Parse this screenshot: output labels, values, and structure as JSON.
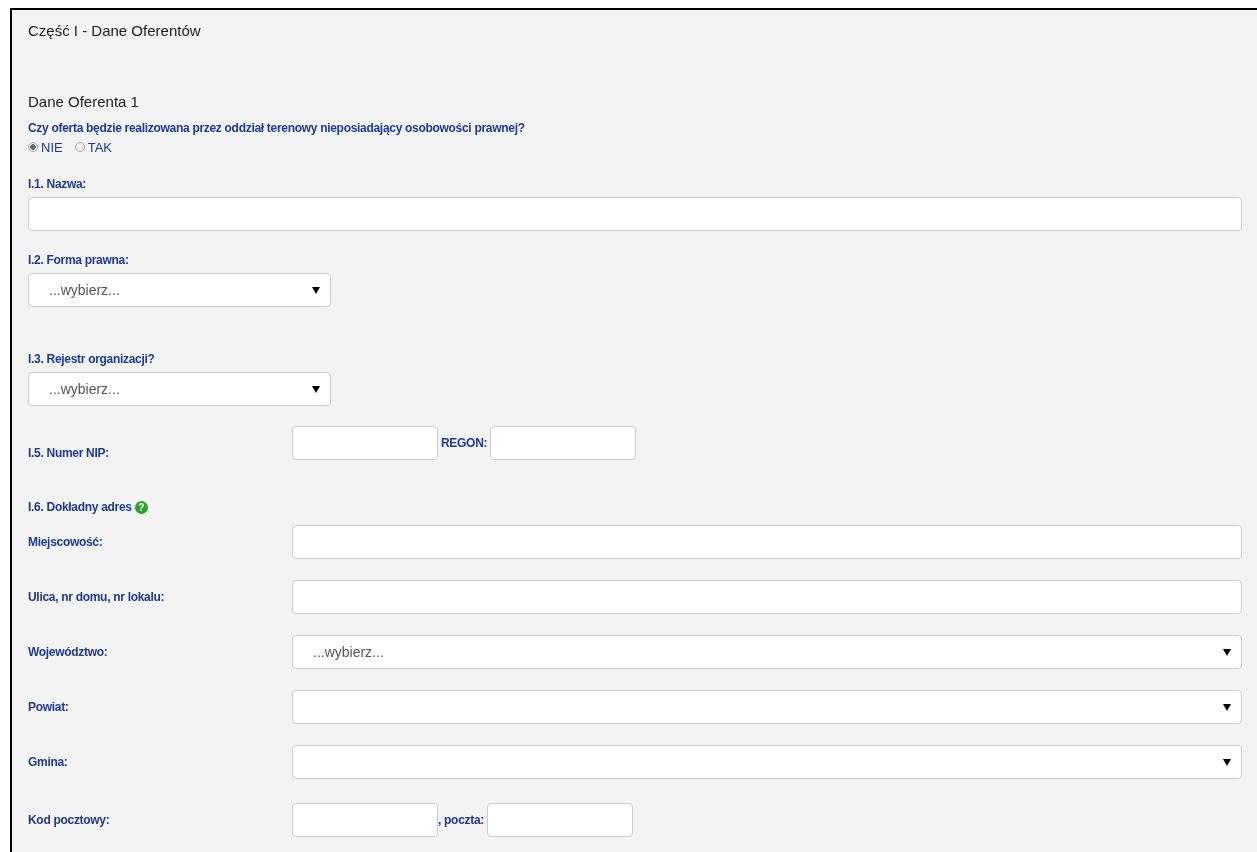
{
  "section_title": "Część I - Dane Oferentów",
  "subsection_title": "Dane Oferenta 1",
  "question": {
    "label": "Czy oferta będzie realizowana przez oddział terenowy nieposiadający osobowości prawnej?",
    "options": [
      {
        "label": "NIE",
        "selected": true
      },
      {
        "label": "TAK",
        "selected": false
      }
    ]
  },
  "fields": [
    {
      "kind": "input",
      "label": "I.1. Nazwa:"
    },
    {
      "kind": "select",
      "label": "I.2. Forma prawna:",
      "value": "...wybierz..."
    },
    {
      "kind": "select",
      "label": "I.3. Rejestr organizacji?",
      "value": "...wybierz..."
    }
  ],
  "nip_row": {
    "label": "I.5. Numer NIP:",
    "second_label": "REGON:"
  },
  "address": {
    "title": "I.6. Dokładny adres",
    "help_glyph": "?",
    "rows": [
      {
        "kind": "input",
        "label": "Miejscowość:"
      },
      {
        "kind": "input",
        "label": "Ulica, nr domu, nr lokalu:"
      },
      {
        "kind": "select",
        "label": "Województwo:",
        "value": "...wybierz..."
      },
      {
        "kind": "select",
        "label": "Powiat:"
      },
      {
        "kind": "select",
        "label": "Gmina:"
      },
      {
        "kind": "pair",
        "label": "Kod pocztowy:",
        "second_label": ", poczta:"
      }
    ]
  }
}
